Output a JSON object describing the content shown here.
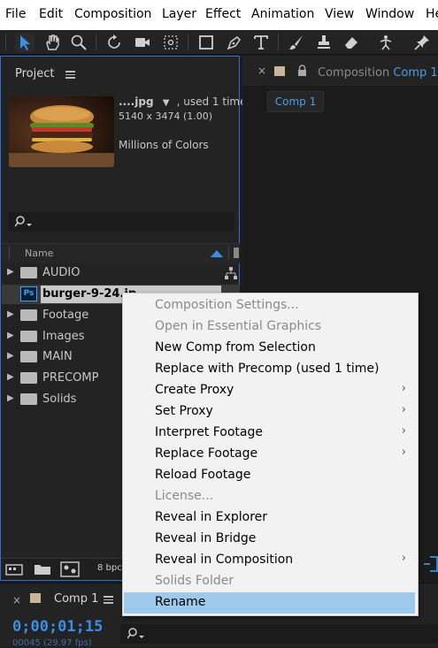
{
  "menubar": {
    "items": [
      "File",
      "Edit",
      "Composition",
      "Layer",
      "Effect",
      "Animation",
      "View",
      "Window",
      "He"
    ]
  },
  "toolbar": {
    "tools": [
      "selection-tool",
      "hand-tool",
      "zoom-tool",
      "rotate-tool",
      "camera-tool",
      "pan-behind-tool",
      "rectangle-tool",
      "pen-tool",
      "type-tool",
      "brush-tool",
      "clone-stamp-tool",
      "eraser-tool",
      "roto-brush-tool",
      "puppet-pin-tool"
    ]
  },
  "project": {
    "tab_label": "Project",
    "file_name": "....jpg",
    "usage": ", used 1 time",
    "dimensions": "5140 x 3474 (1.00)",
    "colors": "Millions of Colors",
    "search_placeholder": "",
    "column_name": "Name",
    "items": [
      {
        "label": "AUDIO",
        "type": "folder"
      },
      {
        "label": "burger-9-24.jp",
        "type": "ps-file"
      },
      {
        "label": "Footage",
        "type": "folder"
      },
      {
        "label": "Images",
        "type": "folder"
      },
      {
        "label": "MAIN",
        "type": "folder"
      },
      {
        "label": "PRECOMP",
        "type": "folder"
      },
      {
        "label": "Solids",
        "type": "folder"
      }
    ],
    "bpc": "8 bpc"
  },
  "composition": {
    "tab_prefix": "Composition",
    "tab_name": "Comp 1",
    "subtab": "Comp 1"
  },
  "timeline": {
    "tab_label": "Comp 1",
    "timecode": "0;00;01;15",
    "fps": "00045 (29.97 fps)"
  },
  "context_menu": {
    "items": [
      {
        "label": "Composition Settings...",
        "disabled": true,
        "submenu": false
      },
      {
        "label": "Open in Essential Graphics",
        "disabled": true,
        "submenu": false
      },
      {
        "label": "New Comp from Selection",
        "disabled": false,
        "submenu": false
      },
      {
        "label": "Replace with Precomp (used 1 time)",
        "disabled": false,
        "submenu": false
      },
      {
        "label": "Create Proxy",
        "disabled": false,
        "submenu": true
      },
      {
        "label": "Set Proxy",
        "disabled": false,
        "submenu": true
      },
      {
        "label": "Interpret Footage",
        "disabled": false,
        "submenu": true
      },
      {
        "label": "Replace Footage",
        "disabled": false,
        "submenu": true
      },
      {
        "label": "Reload Footage",
        "disabled": false,
        "submenu": false
      },
      {
        "label": "License...",
        "disabled": true,
        "submenu": false
      },
      {
        "label": "Reveal in Explorer",
        "disabled": false,
        "submenu": false
      },
      {
        "label": "Reveal in Bridge",
        "disabled": false,
        "submenu": false
      },
      {
        "label": "Reveal in Composition",
        "disabled": false,
        "submenu": true
      },
      {
        "label": "Solids Folder",
        "disabled": true,
        "submenu": false
      },
      {
        "label": "Rename",
        "disabled": false,
        "submenu": false,
        "highlighted": true
      }
    ]
  },
  "colors": {
    "accent": "#2d6fd6",
    "timecode": "#3a8ee6",
    "highlight": "#9fc9eb"
  }
}
